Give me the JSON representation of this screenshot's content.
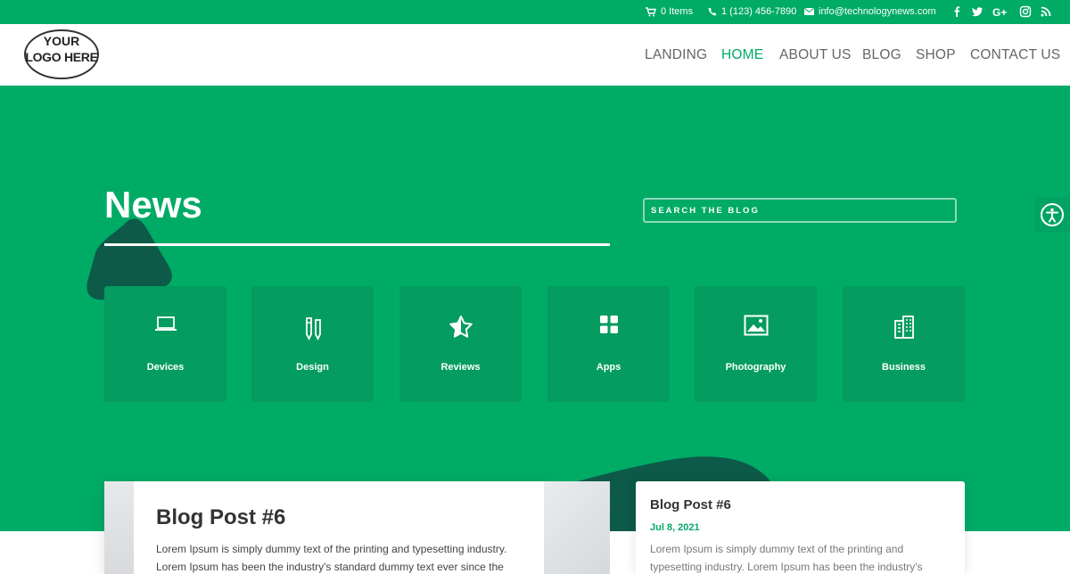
{
  "topbar": {
    "cart": "0 Items",
    "phone": "1 (123) 456-7890",
    "email": "info@technologynews.com",
    "social": [
      "facebook-icon",
      "twitter-icon",
      "google-plus-icon",
      "instagram-icon",
      "rss-icon"
    ]
  },
  "logo": {
    "line1": "YOUR",
    "line2": "LOGO HERE"
  },
  "nav": [
    "LANDING",
    "HOME",
    "ABOUT US",
    "BLOG",
    "SHOP",
    "CONTACT US"
  ],
  "nav_active": "HOME",
  "hero": {
    "title": "News",
    "search_placeholder": "SEARCH THE BLOG"
  },
  "categories": [
    {
      "label": "Devices",
      "icon": "laptop-icon"
    },
    {
      "label": "Design",
      "icon": "pencil-pen-icon"
    },
    {
      "label": "Reviews",
      "icon": "star-icon"
    },
    {
      "label": "Apps",
      "icon": "grid-icon"
    },
    {
      "label": "Photography",
      "icon": "image-icon"
    },
    {
      "label": "Business",
      "icon": "building-icon"
    }
  ],
  "featured_post": {
    "title": "Blog Post #6",
    "excerpt": "Lorem Ipsum is simply dummy text of the printing and typesetting industry. Lorem Ipsum has been the industry's standard dummy text ever since the"
  },
  "side_post": {
    "title": "Blog Post #6",
    "date": "Jul 8, 2021",
    "excerpt": "Lorem Ipsum is simply dummy text of the printing and typesetting industry. Lorem Ipsum has been the industry's"
  },
  "colors": {
    "brand": "#00ab66",
    "dark_accent": "#0d5a48",
    "tile": "#049c60"
  }
}
